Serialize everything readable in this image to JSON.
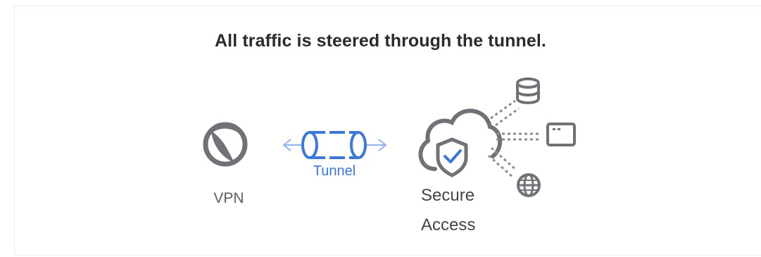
{
  "title": "All traffic is steered through the tunnel.",
  "nodes": {
    "vpn": {
      "label": "VPN",
      "icon": "vpn-client-icon"
    },
    "tunnel": {
      "label": "Tunnel",
      "icon": "tunnel-icon"
    },
    "secure_access": {
      "label_line1": "Secure",
      "label_line2": "Access",
      "icon": "cloud-shield-icon"
    },
    "destinations": [
      {
        "icon": "database-icon"
      },
      {
        "icon": "app-window-icon"
      },
      {
        "icon": "globe-icon"
      }
    ]
  },
  "colors": {
    "title": "#2b2b2b",
    "icon_gray": "#6f7378",
    "tunnel_blue": "#3c78d8",
    "arrow_blue": "#8fb3ea",
    "label_gray": "#5e5e5e"
  }
}
